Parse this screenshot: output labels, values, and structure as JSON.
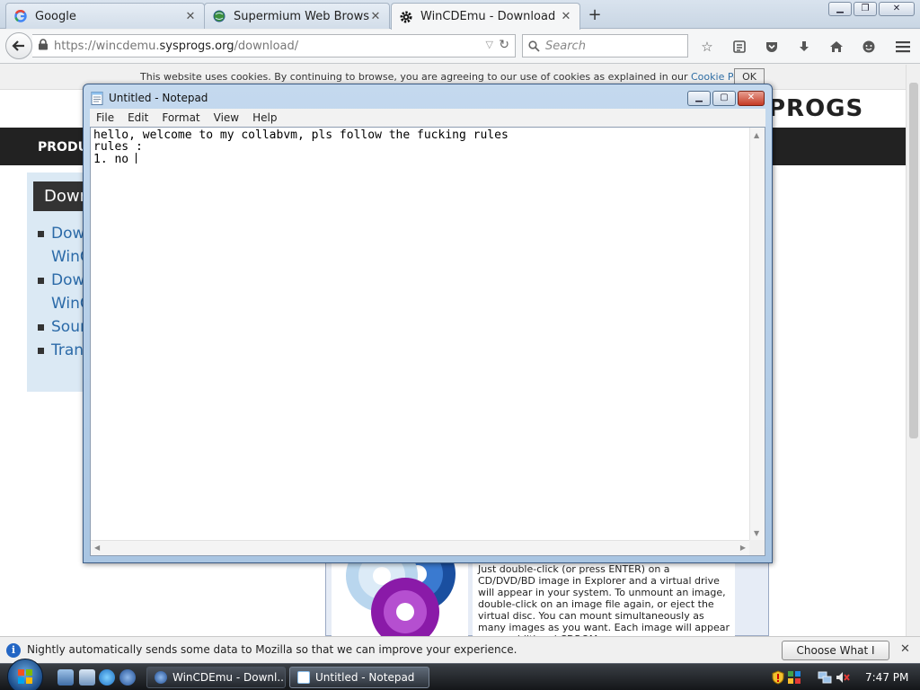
{
  "browser": {
    "tabs": [
      {
        "label": "Google",
        "icon": "google-icon"
      },
      {
        "label": "Supermium Web Browser",
        "icon": "globe-icon"
      },
      {
        "label": "WinCDEmu - Download",
        "icon": "gear-icon",
        "active": true
      }
    ],
    "new_tab_glyph": "+",
    "window_controls": {
      "minimize": "▁",
      "restore": "❐",
      "close": "✕"
    },
    "url": {
      "prefix": "https://wincdemu.",
      "domain": "sysprogs.org",
      "path": "/download/"
    },
    "search_placeholder": "Search"
  },
  "page": {
    "cookie_text": "This website uses cookies. By continuing to browse, you are agreeing to our use of cookies as explained in our ",
    "cookie_link": "Cookie Policy",
    "cookie_period": ".",
    "cookie_ok": "OK",
    "logo": "PROGS",
    "nav_first_item": "PRODU",
    "side_heading": "Down",
    "side_items": [
      "Dow",
      "WinC",
      "Dow",
      "WinC",
      "Sour",
      "Tran"
    ],
    "info_text": "Just double-click (or press ENTER) on a CD/DVD/BD image in Explorer and a virtual drive will appear in your system. To unmount an image, double-click on an image file again, or eject the virtual disc. You can mount simultaneously as many images as you want. Each image will appear as an additional CDROM"
  },
  "notepad": {
    "title": "Untitled - Notepad",
    "menu": [
      "File",
      "Edit",
      "Format",
      "View",
      "Help"
    ],
    "lines": [
      "hello, welcome to my collabvm, pls follow the fucking rules",
      "",
      "rules :",
      "1. no "
    ]
  },
  "notification": {
    "text": "Nightly automatically sends some data to Mozilla so that we can improve your experience.",
    "button": "Choose What I Share",
    "close_glyph": "✕"
  },
  "taskbar": {
    "tasks": [
      {
        "label": "WinCDEmu - Downl...",
        "active": false
      },
      {
        "label": "Untitled - Notepad",
        "active": true
      }
    ],
    "clock": "7:47 PM"
  }
}
